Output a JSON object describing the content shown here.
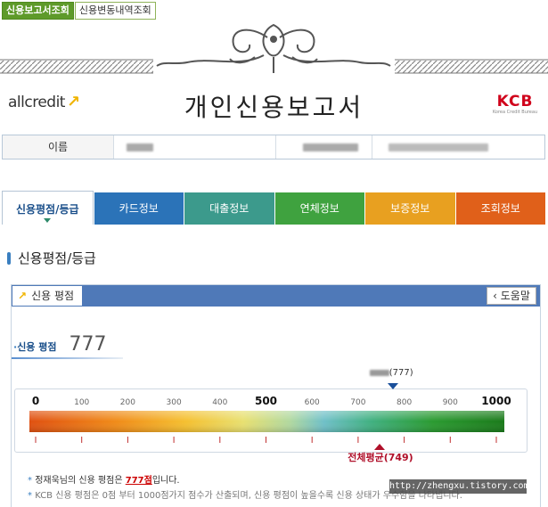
{
  "top_tabs": [
    {
      "label": "신용보고서조회",
      "active": true
    },
    {
      "label": "신용변동내역조회",
      "active": false
    }
  ],
  "header": {
    "title": "개인신용보고서",
    "left_logo": "allcredit",
    "right_logo": "KCB",
    "right_logo_sub": "Korea Credit Bureau"
  },
  "name_row": {
    "label": "이름"
  },
  "category_tabs": [
    {
      "label": "신용평점/등급",
      "color": "#ffffff",
      "active": true
    },
    {
      "label": "카드정보",
      "color": "#2b73b8",
      "active": false
    },
    {
      "label": "대출정보",
      "color": "#3c9a8c",
      "active": false
    },
    {
      "label": "연체정보",
      "color": "#3fa23f",
      "active": false
    },
    {
      "label": "보증정보",
      "color": "#e8a020",
      "active": false
    },
    {
      "label": "조회정보",
      "color": "#e0601a",
      "active": false
    }
  ],
  "section_title": "신용평점/등급",
  "panel": {
    "tab_label": "신용 평점",
    "help_label": "도움말",
    "score_label": "신용 평점",
    "score": "777"
  },
  "gauge": {
    "ticks": [
      "0",
      "100",
      "200",
      "300",
      "400",
      "500",
      "600",
      "700",
      "800",
      "900",
      "1000"
    ],
    "bold_ticks": [
      "0",
      "500",
      "1000"
    ],
    "user_marker_label": "(777)",
    "user_score": 777,
    "average_label": "전체평균(749)",
    "average_score": 749,
    "min": 0,
    "max": 1000
  },
  "notes": [
    {
      "prefix": "정재욱님의 신용 평점은 ",
      "highlight": "777점",
      "suffix": "입니다."
    },
    {
      "text": "KCB 신용 평점은 0점 부터 1000점가지 점수가 산출되며, 신용 평점이 높을수록 신용 상태가 우수함을 나타냅니다."
    }
  ],
  "watermark": "http://zhengxu.tistory.com"
}
